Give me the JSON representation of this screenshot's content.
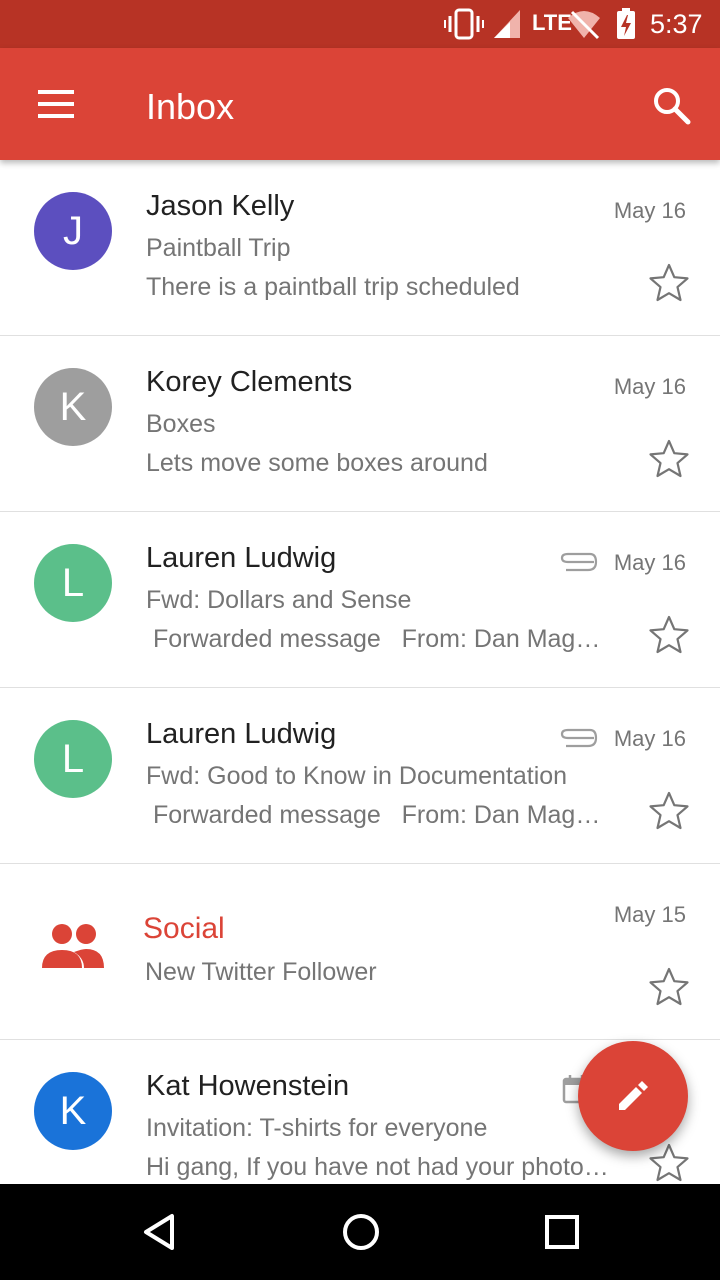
{
  "status_bar": {
    "network": "LTE",
    "time": "5:37",
    "icons": [
      "vibrate-icon",
      "signal-icon",
      "wifi-off-icon",
      "battery-charging-icon"
    ]
  },
  "app_bar": {
    "title": "Inbox",
    "icons": [
      "menu-icon",
      "search-icon"
    ]
  },
  "emails": [
    {
      "sender": "Jason Kelly",
      "initial": "J",
      "avatar_color": "#5c4fbf",
      "subject": "Paintball Trip",
      "snippet": "There is a paintball trip scheduled",
      "date": "May 16",
      "attachment": false
    },
    {
      "sender": "Korey Clements",
      "initial": "K",
      "avatar_color": "#9e9e9e",
      "subject": "Boxes",
      "snippet": "Lets move some boxes around",
      "date": "May 16",
      "attachment": false
    },
    {
      "sender": "Lauren Ludwig",
      "initial": "L",
      "avatar_color": "#5bbf8a",
      "subject": "Fwd: Dollars and Sense",
      "snippet": " Forwarded message   From: Dan Mag…",
      "date": "May 16",
      "attachment": true
    },
    {
      "sender": "Lauren Ludwig",
      "initial": "L",
      "avatar_color": "#5bbf8a",
      "subject": "Fwd: Good to Know in Documentation",
      "snippet": " Forwarded message   From: Dan Mag…",
      "date": "May 16",
      "attachment": true
    }
  ],
  "social": {
    "label": "Social",
    "subtitle": "New Twitter Follower",
    "date": "May 15",
    "color": "#db4437"
  },
  "last_email": {
    "sender": "Kat Howenstein",
    "initial": "K",
    "avatar_color": "#1a73d9",
    "subject": "Invitation: T-shirts for everyone",
    "snippet": "Hi gang, If you have not had your photo…"
  },
  "fab": {
    "icon": "pencil-icon",
    "color": "#db4437"
  },
  "nav_bar": {
    "icons": [
      "back-icon",
      "home-icon",
      "recents-icon"
    ]
  },
  "colors": {
    "app_bar": "#db4437",
    "status_bar": "#b73325"
  }
}
